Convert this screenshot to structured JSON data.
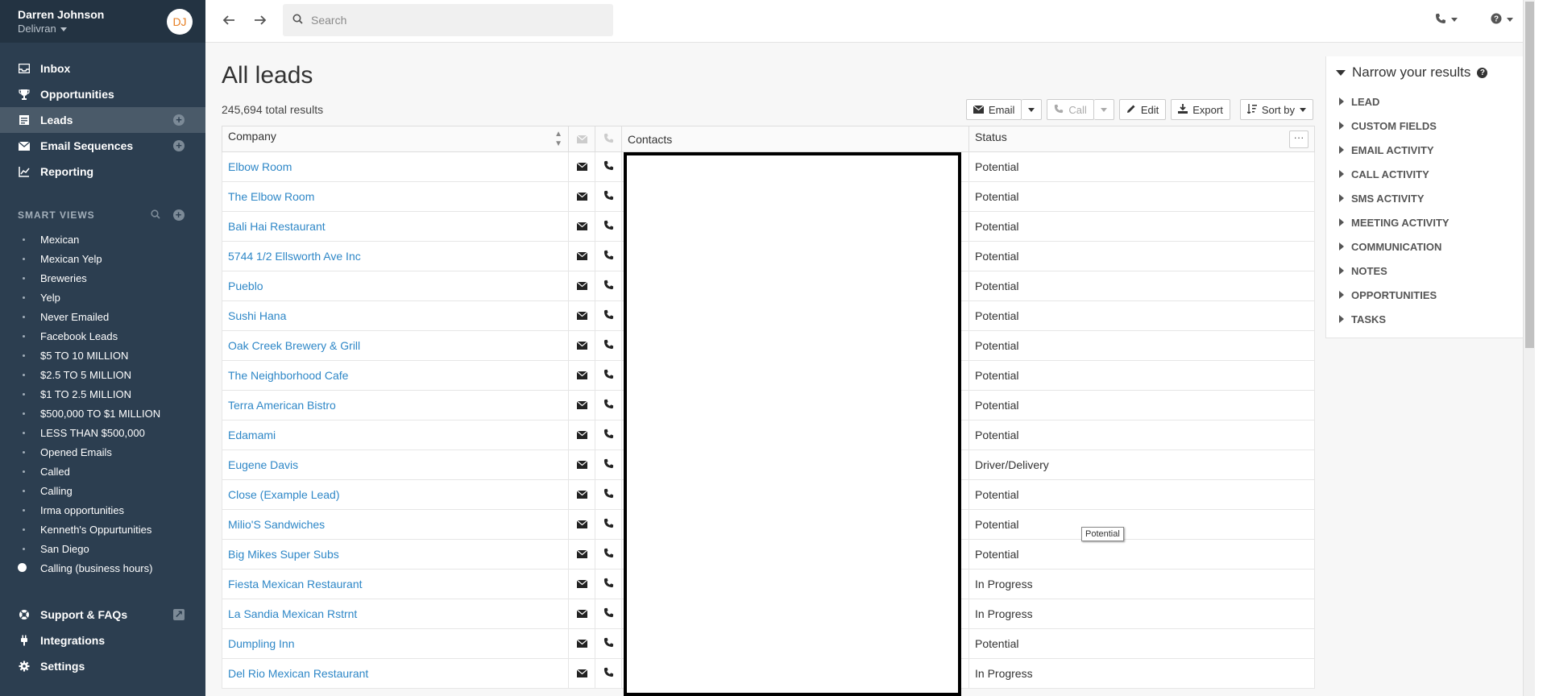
{
  "user": {
    "name": "Darren Johnson",
    "org": "Delivran",
    "initials": "DJ"
  },
  "nav": {
    "inbox": "Inbox",
    "opportunities": "Opportunities",
    "leads": "Leads",
    "email_sequences": "Email Sequences",
    "reporting": "Reporting"
  },
  "smart_views": {
    "heading": "SMART VIEWS",
    "items": [
      "Mexican",
      "Mexican Yelp",
      "Breweries",
      "Yelp",
      "Never Emailed",
      "Facebook Leads",
      "$5 TO 10 MILLION",
      "$2.5 TO 5 MILLION",
      "$1 TO 2.5 MILLION",
      "$500,000 TO $1 MILLION",
      "LESS THAN $500,000",
      "Opened Emails",
      "Called",
      "Calling",
      "Irma opportunities",
      "Kenneth's Oppurtunities",
      "San Diego",
      "Calling (business hours)"
    ]
  },
  "bottom_nav": {
    "support": "Support & FAQs",
    "integrations": "Integrations",
    "settings": "Settings"
  },
  "search": {
    "placeholder": "Search"
  },
  "page": {
    "title": "All leads",
    "total": "245,694 total results"
  },
  "toolbar": {
    "email": "Email",
    "call": "Call",
    "edit": "Edit",
    "export": "Export",
    "sort": "Sort by"
  },
  "table": {
    "headers": {
      "company": "Company",
      "contacts": "Contacts",
      "status": "Status",
      "menu": "···"
    },
    "rows": [
      {
        "company": "Elbow Room",
        "status": "Potential"
      },
      {
        "company": "The Elbow Room",
        "status": "Potential"
      },
      {
        "company": "Bali Hai Restaurant",
        "status": "Potential"
      },
      {
        "company": "5744 1/2 Ellsworth Ave Inc",
        "status": "Potential"
      },
      {
        "company": "Pueblo",
        "status": "Potential"
      },
      {
        "company": "Sushi Hana",
        "status": "Potential"
      },
      {
        "company": "Oak Creek Brewery & Grill",
        "status": "Potential"
      },
      {
        "company": "The Neighborhood Cafe",
        "status": "Potential"
      },
      {
        "company": "Terra American Bistro",
        "status": "Potential"
      },
      {
        "company": "Edamami",
        "status": "Potential"
      },
      {
        "company": "Eugene Davis",
        "status": "Driver/Delivery"
      },
      {
        "company": "Close (Example Lead)",
        "status": "Potential"
      },
      {
        "company": "Milio'S Sandwiches",
        "status": "Potential"
      },
      {
        "company": "Big Mikes Super Subs",
        "status": "Potential"
      },
      {
        "company": "Fiesta Mexican Restaurant",
        "status": "In Progress"
      },
      {
        "company": "La Sandia Mexican Rstrnt",
        "status": "In Progress"
      },
      {
        "company": "Dumpling Inn",
        "status": "Potential"
      },
      {
        "company": "Del Rio Mexican Restaurant",
        "status": "In Progress"
      }
    ]
  },
  "tooltip": "Potential",
  "filters": {
    "title": "Narrow your results",
    "items": [
      "LEAD",
      "CUSTOM FIELDS",
      "EMAIL ACTIVITY",
      "CALL ACTIVITY",
      "SMS ACTIVITY",
      "MEETING ACTIVITY",
      "COMMUNICATION",
      "NOTES",
      "OPPORTUNITIES",
      "TASKS"
    ]
  }
}
